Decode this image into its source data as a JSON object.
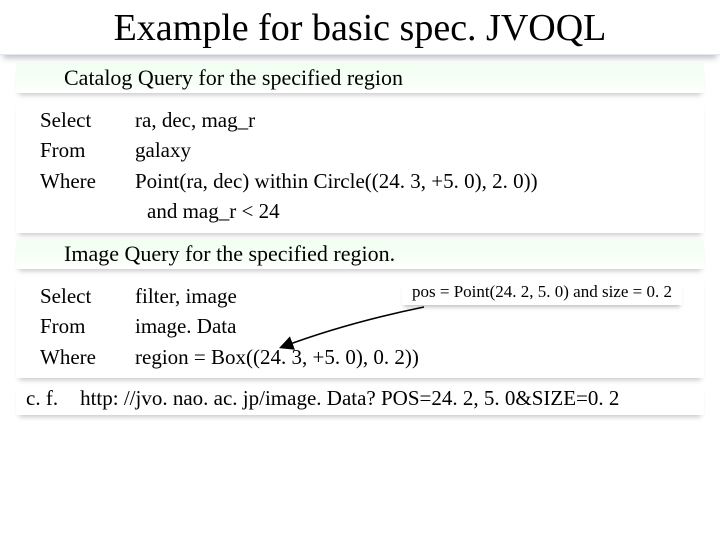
{
  "title": "Example for basic spec. JVOQL",
  "section1": "Catalog Query for the specified region",
  "q1": {
    "kw_select": "Select",
    "kw_from": "From",
    "kw_where": "Where",
    "select": "ra, dec, mag_r",
    "from": "galaxy",
    "where": "Point(ra, dec)  within  Circle((24. 3, +5. 0), 2. 0))",
    "where2": "and mag_r < 24"
  },
  "section2": "Image Query for the specified region.",
  "q2": {
    "kw_select": "Select",
    "kw_from": "From",
    "kw_where": "Where",
    "select": "filter, image",
    "from": "image. Data",
    "where": "region = Box((24. 3, +5. 0), 0. 2))"
  },
  "annotation": "pos = Point(24. 2, 5. 0) and size = 0. 2",
  "cf_label": "c. f.",
  "cf_url": "http: //jvo. nao. ac. jp/image. Data? POS=24. 2, 5. 0&SIZE=0. 2"
}
